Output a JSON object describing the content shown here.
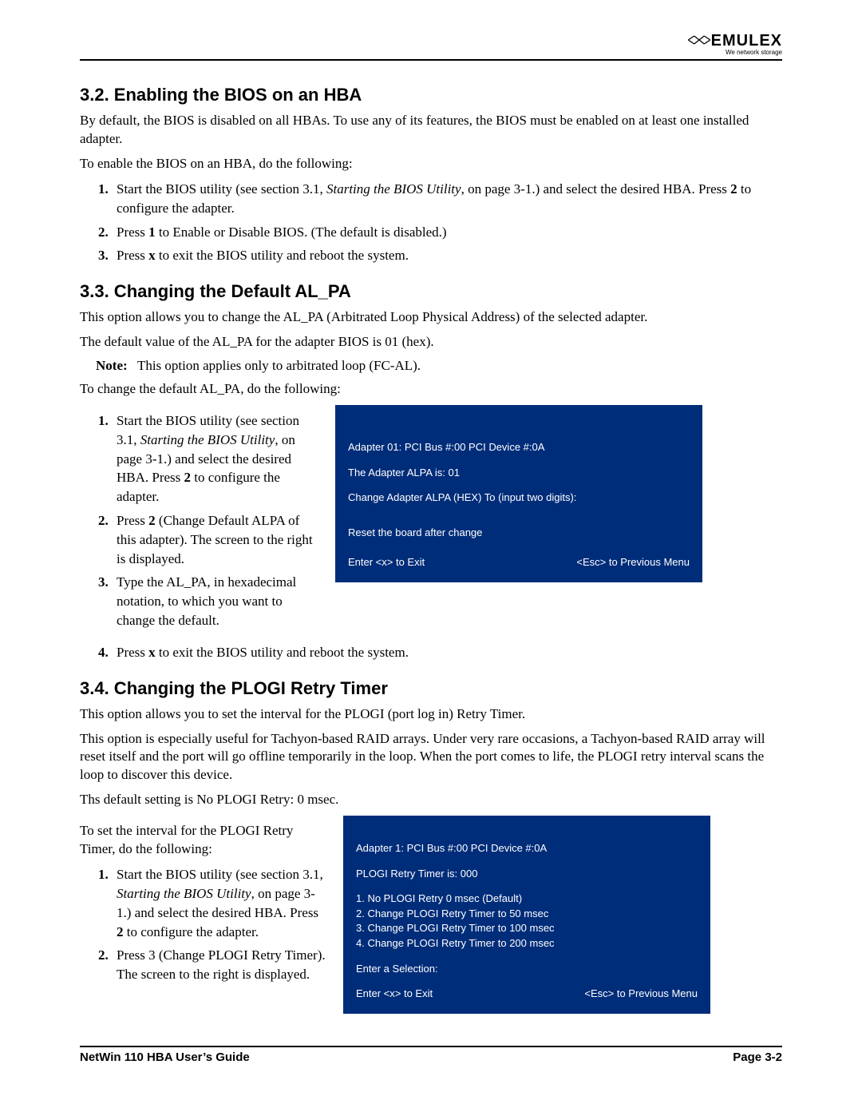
{
  "brand": {
    "name": "EMULEX",
    "tagline": "We network storage"
  },
  "s32": {
    "heading": "3.2. Enabling the BIOS on an HBA",
    "p1": "By default, the BIOS is disabled on all HBAs. To use any of its features, the BIOS must be enabled on at least one installed adapter.",
    "p2": "To enable the BIOS on an HBA, do the following:",
    "step1a": "Start the BIOS utility (see section 3.1, ",
    "step1i": "Starting the BIOS Utility",
    "step1b": ", on page 3-1.) and select the desired HBA. Press ",
    "step1c": " to configure the adapter.",
    "step2a": "Press ",
    "step2b": " to Enable or Disable BIOS. (The default is disabled.)",
    "step3a": "Press ",
    "step3b": " to exit the BIOS utility and reboot the system.",
    "k2": "2",
    "k1": "1",
    "kx": "x"
  },
  "s33": {
    "heading": "3.3. Changing the Default AL_PA",
    "p1": "This option allows you to change the AL_PA (Arbitrated Loop Physical Address) of the selected adapter.",
    "p2": "The default value of the AL_PA for the adapter BIOS is 01 (hex).",
    "note_label": "Note:",
    "note_text": "This option applies only to arbitrated loop (FC-AL).",
    "p3": "To change the default AL_PA, do the following:",
    "step1a": "Start the BIOS utility (see section 3.1, ",
    "step1i": "Starting the BIOS Utility",
    "step1b": ", on page 3-1.) and select the desired HBA. Press ",
    "step1c": " to configure the adapter.",
    "step2a": "Press ",
    "step2b": " (Change Default ALPA of this adapter). The screen to the right is displayed.",
    "step3": "Type the AL_PA, in hexadecimal notation, to which you want to change the default.",
    "step4a": "Press ",
    "step4b": " to exit the BIOS utility and reboot the system.",
    "k2": "2",
    "kx": "x",
    "screen": {
      "l1": "Adapter 01: PCI Bus #:00 PCI Device #:0A",
      "l2": "The Adapter ALPA is: 01",
      "l3": "Change Adapter ALPA (HEX) To (input two digits):",
      "l4": "Reset the board after change",
      "foot_left": "Enter <x> to Exit",
      "foot_right": "<Esc> to Previous Menu"
    }
  },
  "s34": {
    "heading": "3.4. Changing the PLOGI Retry Timer",
    "p1": "This option allows you to set the interval for the PLOGI (port log in) Retry Timer.",
    "p2": "This option is especially useful for Tachyon-based RAID arrays. Under very rare occasions, a Tachyon-based RAID array will reset itself and the port will go offline temporarily in the loop. When the port comes to life, the PLOGI retry interval scans the loop to discover this device.",
    "p3": "Ths default setting is No PLOGI Retry: 0 msec.",
    "p4": "To set the interval for the PLOGI Retry Timer, do the following:",
    "step1a": "Start the BIOS utility (see section 3.1, ",
    "step1i": "Starting the BIOS Utility",
    "step1b": ", on page 3-1.) and select the desired HBA. Press ",
    "step1c": " to configure the adapter.",
    "step2": "Press 3 (Change PLOGI Retry Timer). The screen to the right is displayed.",
    "k2": "2",
    "screen": {
      "l1": "Adapter 1: PCI Bus #:00 PCI Device #:0A",
      "l2": "PLOGI Retry Timer is: 000",
      "opt1": "1.  No PLOGI Retry 0 msec (Default)",
      "opt2": "2.  Change PLOGI Retry Timer to  50 msec",
      "opt3": "3.  Change PLOGI Retry Timer to  100 msec",
      "opt4": "4.  Change PLOGI Retry Timer to  200 msec",
      "prompt": "Enter a Selection:",
      "foot_left": "Enter <x> to Exit",
      "foot_right": "<Esc> to Previous Menu"
    }
  },
  "footer": {
    "left": "NetWin 110 HBA User’s Guide",
    "right": "Page 3-2"
  }
}
